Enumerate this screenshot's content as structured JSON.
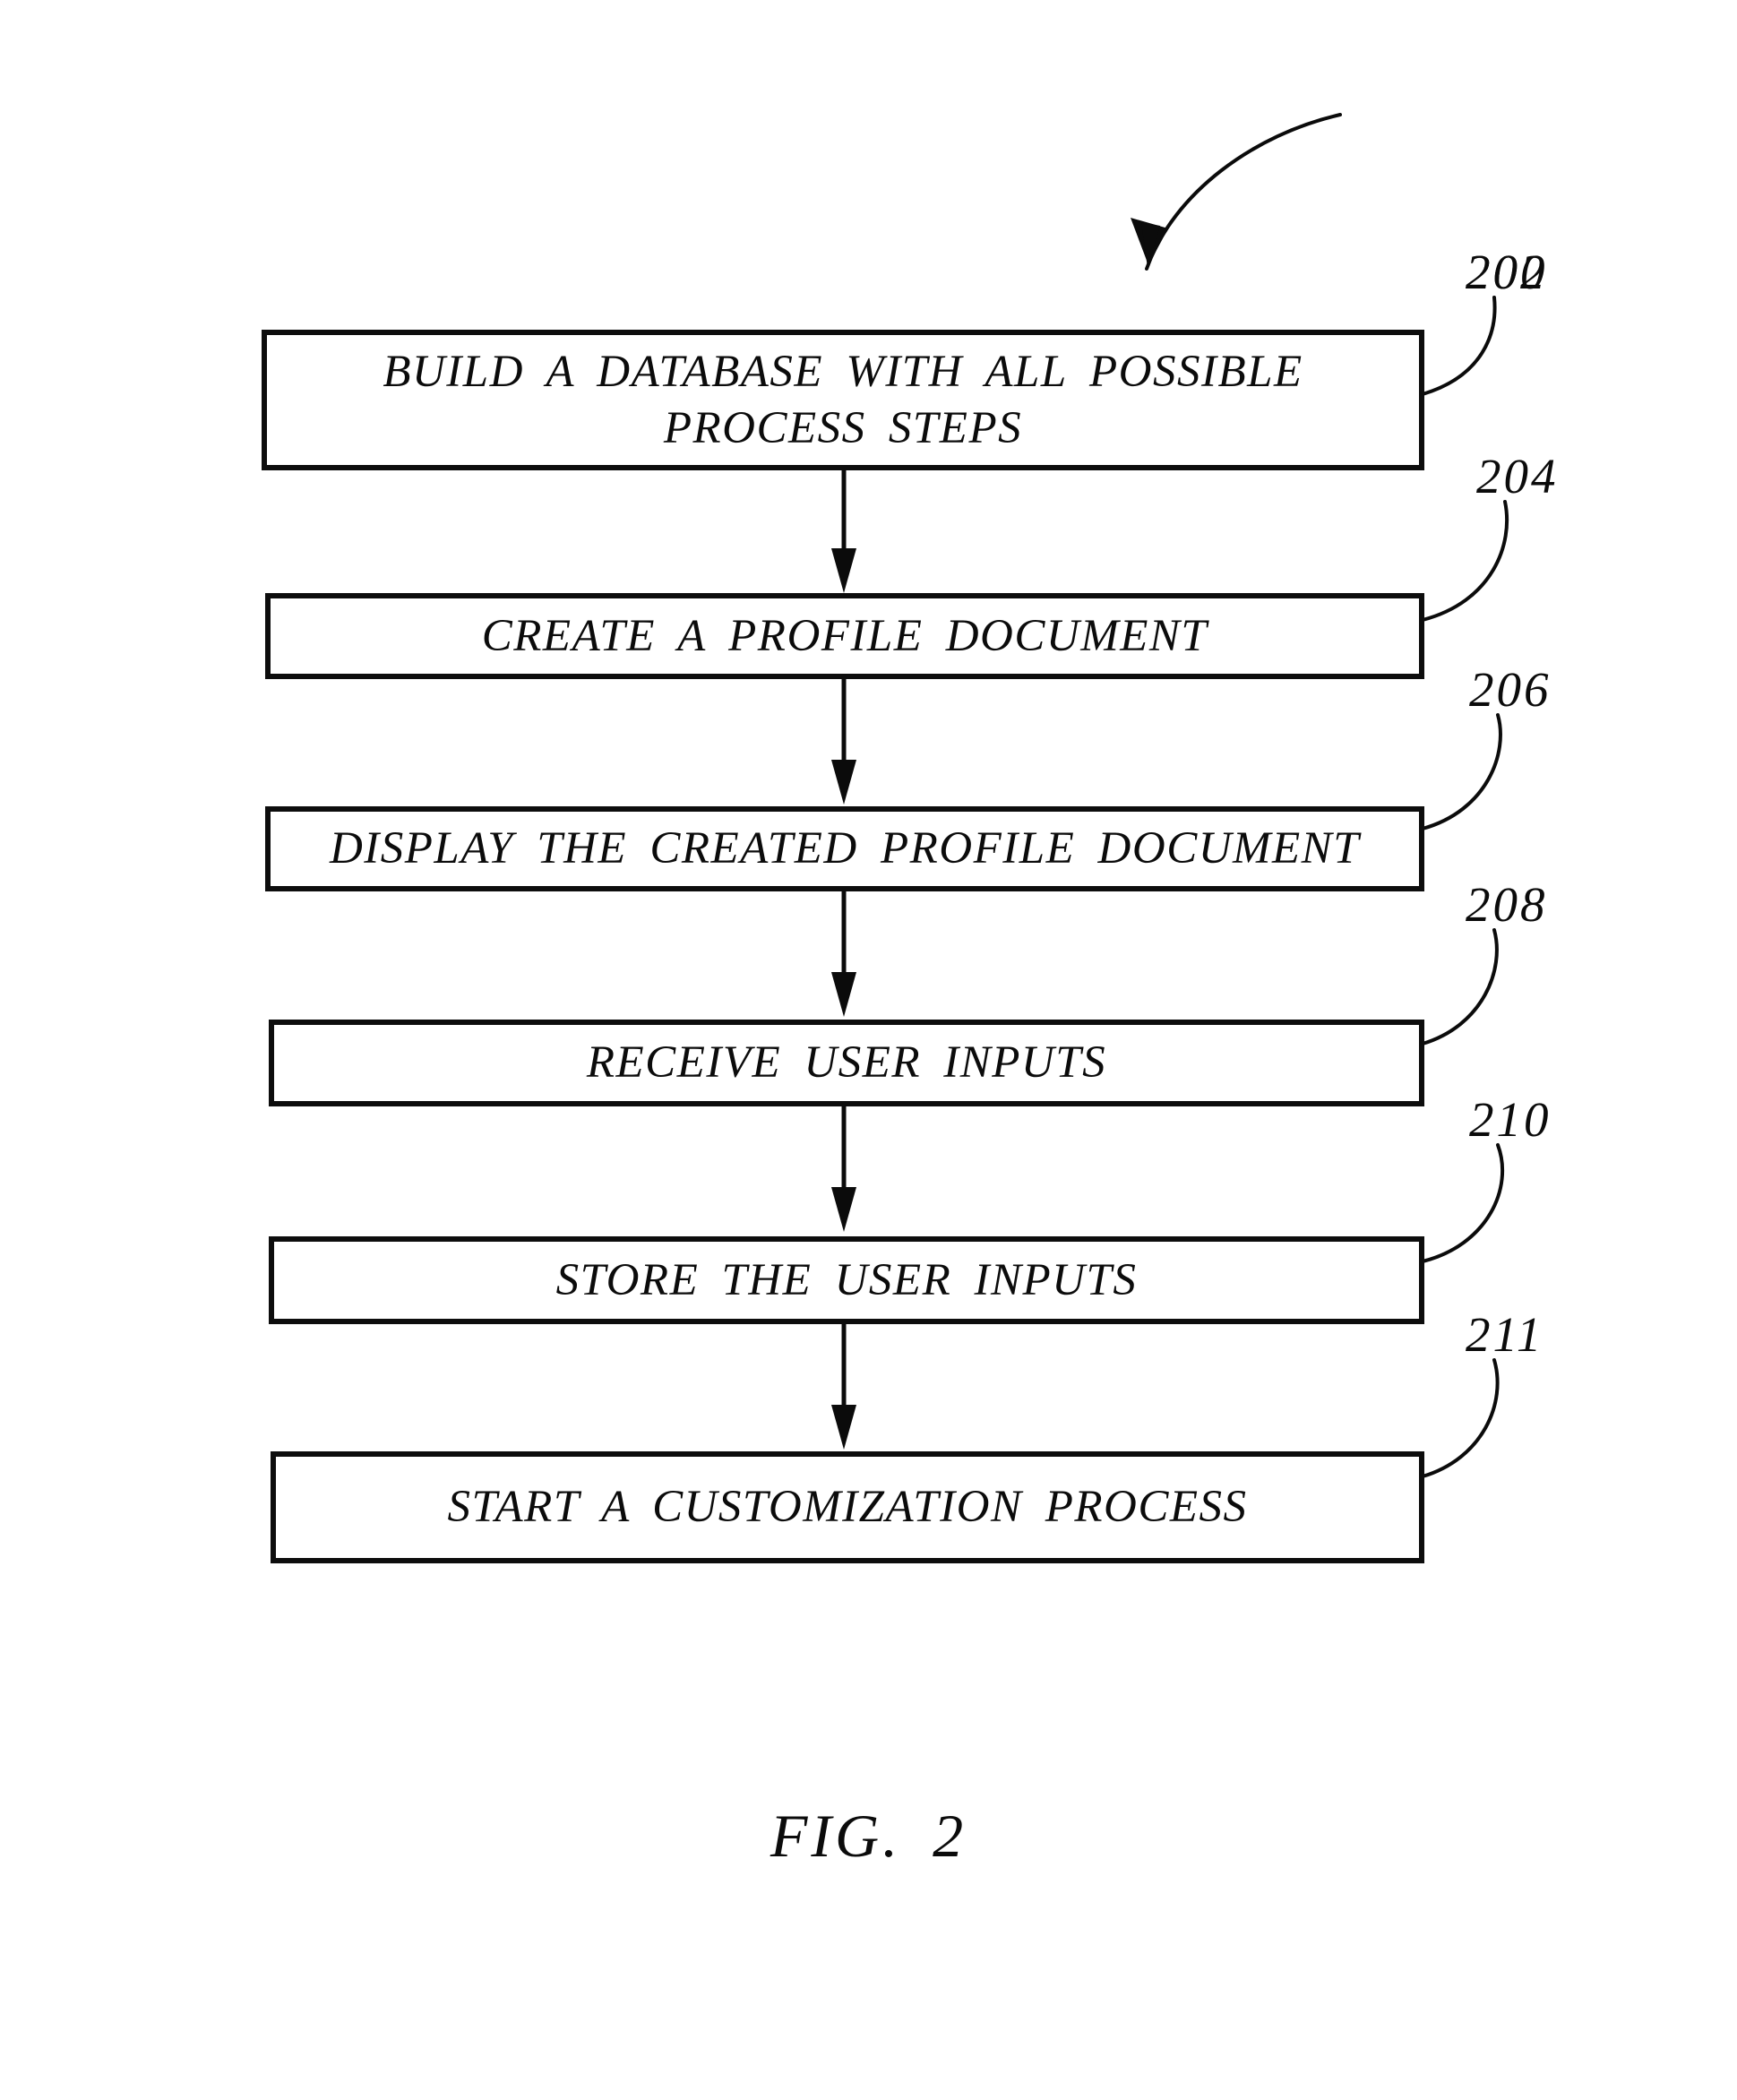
{
  "figure": {
    "caption": "FIG. 2",
    "diagram_label": "200",
    "ink_color": "#0b0b0b",
    "background_color": "#ffffff"
  },
  "flowchart": {
    "type": "flowchart",
    "orientation": "vertical-top-to-bottom",
    "steps": [
      {
        "ref": "202",
        "text": "BUILD A DATABASE WITH ALL POSSIBLE\nPROCESS STEPS",
        "lines": 2
      },
      {
        "ref": "204",
        "text": "CREATE A PROFILE DOCUMENT",
        "lines": 1
      },
      {
        "ref": "206",
        "text": "DISPLAY THE CREATED PROFILE DOCUMENT",
        "lines": 1
      },
      {
        "ref": "208",
        "text": "RECEIVE USER INPUTS",
        "lines": 1
      },
      {
        "ref": "210",
        "text": "STORE THE USER INPUTS",
        "lines": 1
      },
      {
        "ref": "211",
        "text": "START A CUSTOMIZATION PROCESS",
        "lines": 1
      }
    ],
    "connectors": [
      {
        "from": "202",
        "to": "204",
        "style": "arrow-down"
      },
      {
        "from": "204",
        "to": "206",
        "style": "arrow-down"
      },
      {
        "from": "206",
        "to": "208",
        "style": "arrow-down"
      },
      {
        "from": "208",
        "to": "210",
        "style": "arrow-down"
      },
      {
        "from": "210",
        "to": "211",
        "style": "arrow-down"
      }
    ]
  }
}
